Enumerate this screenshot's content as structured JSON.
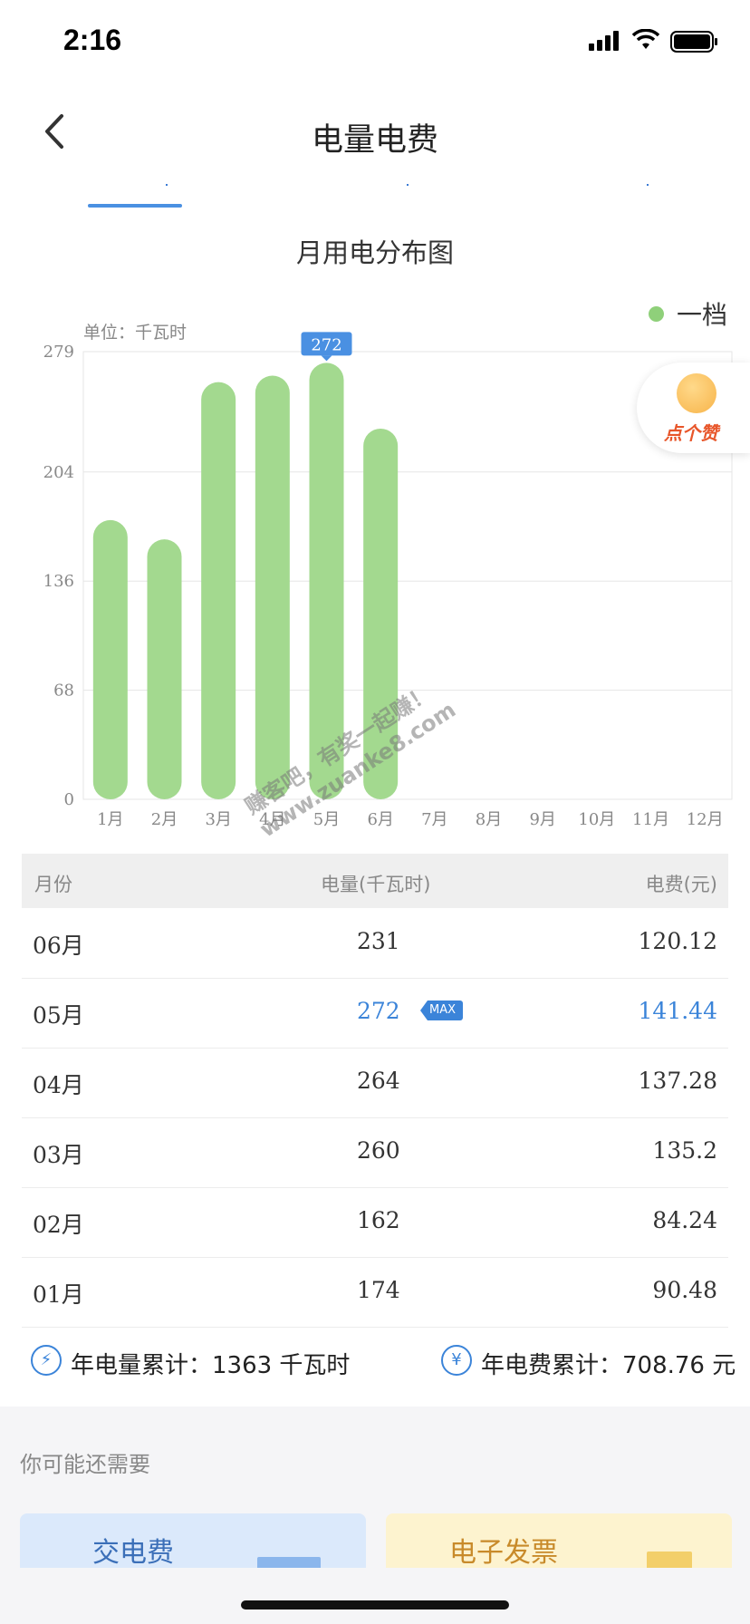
{
  "status_bar": {
    "time": "2:16"
  },
  "header": {
    "title": "电量电费",
    "back_icon": "chevron-left-icon"
  },
  "chart": {
    "title": "月用电分布图",
    "unit_label": "单位：千瓦时",
    "legend_label": "一档",
    "tooltip_value": "272",
    "like_badge_label": "点个赞"
  },
  "chart_data": {
    "type": "bar",
    "title": "月用电分布图",
    "ylabel": "单位：千瓦时",
    "categories": [
      "1月",
      "2月",
      "3月",
      "4月",
      "5月",
      "6月",
      "7月",
      "8月",
      "9月",
      "10月",
      "11月",
      "12月"
    ],
    "series": [
      {
        "name": "一档",
        "values": [
          174,
          162,
          260,
          264,
          272,
          231,
          null,
          null,
          null,
          null,
          null,
          null
        ]
      }
    ],
    "yticks": [
      0,
      68,
      136,
      204,
      279
    ],
    "ylim": [
      0,
      279
    ],
    "highlight": {
      "category": "5月",
      "value": 272
    },
    "grid": true,
    "legend": "top-right",
    "colors": {
      "bar": "#a3d98f",
      "tooltip": "#4a90e2"
    }
  },
  "table": {
    "headers": {
      "month": "月份",
      "kwh": "电量(千瓦时)",
      "fee": "电费(元)"
    },
    "rows": [
      {
        "month": "06月",
        "kwh": "231",
        "fee": "120.12"
      },
      {
        "month": "05月",
        "kwh": "272",
        "fee": "141.44"
      },
      {
        "month": "04月",
        "kwh": "264",
        "fee": "137.28"
      },
      {
        "month": "03月",
        "kwh": "260",
        "fee": "135.2"
      },
      {
        "month": "02月",
        "kwh": "162",
        "fee": "84.24"
      },
      {
        "month": "01月",
        "kwh": "174",
        "fee": "90.48"
      }
    ],
    "max_badge": "MAX"
  },
  "summary": {
    "kwh_icon": "lightning-icon",
    "kwh_text": "年电量累计：1363 千瓦时",
    "fee_icon": "yen-icon",
    "fee_text": "年电费累计：708.76 元"
  },
  "more": {
    "title": "你可能还需要",
    "cards": [
      {
        "label": "交电费"
      },
      {
        "label": "电子发票"
      }
    ]
  },
  "watermark": {
    "line1": "赚客吧，有奖一起赚！",
    "line2": "www.zuanke8.com"
  },
  "colors": {
    "accent": "#3b84d9",
    "bar": "#a3d98f"
  }
}
